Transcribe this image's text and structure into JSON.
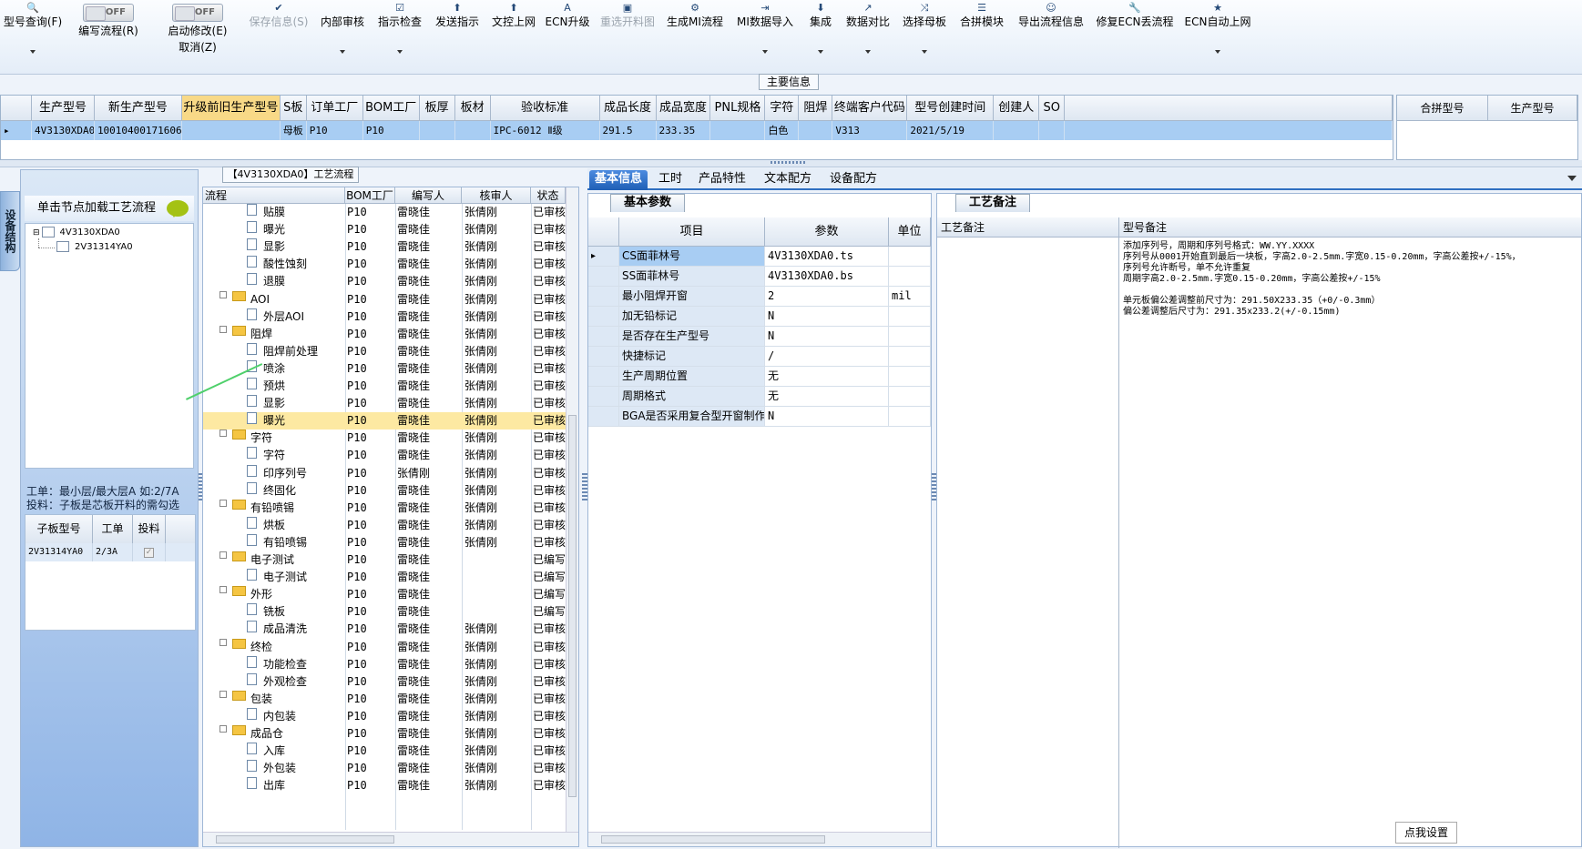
{
  "toolbar": {
    "items": [
      {
        "icon": "🔍",
        "label": "型号查询(F)",
        "caret": true,
        "disabled": false,
        "w": 72
      },
      {
        "toggle": true,
        "state": "OFF",
        "label": "编写流程(R)",
        "w": 94
      },
      {
        "toggle": true,
        "state": "OFF",
        "label": "启动修改(E)",
        "label2": "取消(Z)",
        "w": 102
      },
      {
        "icon": "✔",
        "label": "保存信息(S)",
        "caret": false,
        "disabled": true,
        "w": 76
      },
      {
        "icon": "",
        "label": "内部审核",
        "caret": true,
        "disabled": false,
        "w": 64
      },
      {
        "icon": "☑",
        "label": "指示检查",
        "caret": true,
        "disabled": false,
        "w": 62
      },
      {
        "icon": "⬆",
        "label": "发送指示",
        "caret": false,
        "disabled": false,
        "w": 64
      },
      {
        "icon": "⬆",
        "label": "文控上网",
        "caret": false,
        "disabled": false,
        "w": 60
      },
      {
        "icon": "A",
        "label": "ECN升级",
        "caret": false,
        "disabled": false,
        "w": 58
      },
      {
        "icon": "▣",
        "label": "重选开料图",
        "caret": false,
        "disabled": true,
        "w": 74
      },
      {
        "icon": "⚙",
        "label": "生成MI流程",
        "caret": false,
        "disabled": false,
        "w": 74
      },
      {
        "icon": "⇥",
        "label": "MI数据导入",
        "caret": true,
        "disabled": false,
        "w": 80
      },
      {
        "icon": "⬇",
        "label": "集成",
        "caret": true,
        "disabled": false,
        "w": 42
      },
      {
        "icon": "↗",
        "label": "数据对比",
        "caret": true,
        "disabled": false,
        "w": 62
      },
      {
        "icon": "⤨",
        "label": "选择母板",
        "caret": true,
        "disabled": false,
        "w": 62
      },
      {
        "icon": "☰",
        "label": "合拼模块",
        "caret": false,
        "disabled": false,
        "w": 64
      },
      {
        "icon": "☺",
        "label": "导出流程信息",
        "caret": false,
        "disabled": false,
        "w": 88
      },
      {
        "icon": "🔧",
        "label": "修复ECN丢流程",
        "caret": false,
        "disabled": false,
        "w": 96
      },
      {
        "icon": "★",
        "label": "ECN自动上网",
        "caret": true,
        "disabled": false,
        "w": 86
      }
    ]
  },
  "main_info_label": "主要信息",
  "main_grid": {
    "columns": [
      {
        "label": "",
        "w": 34
      },
      {
        "label": "生产型号",
        "w": 69
      },
      {
        "label": "新生产型号",
        "w": 96
      },
      {
        "label": "升级前旧生产型号",
        "w": 108,
        "hl": true
      },
      {
        "label": "S板",
        "w": 29
      },
      {
        "label": "订单工厂",
        "w": 62
      },
      {
        "label": "BOM工厂",
        "w": 62
      },
      {
        "label": "板厚",
        "w": 39
      },
      {
        "label": "板材",
        "w": 39
      },
      {
        "label": "验收标准",
        "w": 120
      },
      {
        "label": "成品长度",
        "w": 62
      },
      {
        "label": "成品宽度",
        "w": 60
      },
      {
        "label": "PNL规格",
        "w": 60
      },
      {
        "label": "字符",
        "w": 37
      },
      {
        "label": "阻焊",
        "w": 37
      },
      {
        "label": "终端客户代码",
        "w": 82
      },
      {
        "label": "型号创建时间",
        "w": 95
      },
      {
        "label": "创建人",
        "w": 50
      },
      {
        "label": "SO",
        "w": 28
      },
      {
        "label": "",
        "w": 360
      }
    ],
    "row": [
      "▸",
      "4V3130XDA0",
      "10010400171606",
      "",
      "母板",
      "P10",
      "P10",
      "",
      "",
      "IPC-6012 Ⅱ级",
      "291.5",
      "233.35",
      "",
      "白色",
      "",
      "V313",
      "2021/5/19",
      "",
      "",
      ""
    ]
  },
  "side_grid": {
    "columns": [
      "合拼型号",
      "生产型号"
    ]
  },
  "left_tab_label": "设备结构",
  "left_panel": {
    "hint": "单击节点加载工艺流程",
    "tree": [
      "4V3130XDA0",
      "2V31314YA0"
    ],
    "info_line1": "工单：最小层/最大层A 如:2/7A",
    "info_line2": "投料：子板是芯板开料的需勾选",
    "sub_grid": {
      "columns": [
        "子板型号",
        "工单",
        "投料"
      ],
      "row": {
        "model": "2V31314YA0",
        "order": "2/3A",
        "feed_mark": "✓"
      }
    }
  },
  "process_title": "【4V3130XDA0】工艺流程",
  "process_grid": {
    "columns": [
      "流程",
      "BOM工厂",
      "编写人",
      "核审人",
      "状态"
    ],
    "rows": [
      {
        "t": "c",
        "name": "贴膜",
        "bom": "P10",
        "w": "雷晓佳",
        "r": "张倩刚",
        "s": "已审核"
      },
      {
        "t": "c",
        "name": "曝光",
        "bom": "P10",
        "w": "雷晓佳",
        "r": "张倩刚",
        "s": "已审核"
      },
      {
        "t": "c",
        "name": "显影",
        "bom": "P10",
        "w": "雷晓佳",
        "r": "张倩刚",
        "s": "已审核"
      },
      {
        "t": "c",
        "name": "酸性蚀刻",
        "bom": "P10",
        "w": "雷晓佳",
        "r": "张倩刚",
        "s": "已审核"
      },
      {
        "t": "c",
        "name": "退膜",
        "bom": "P10",
        "w": "雷晓佳",
        "r": "张倩刚",
        "s": "已审核"
      },
      {
        "t": "g",
        "name": "AOI",
        "bom": "P10",
        "w": "雷晓佳",
        "r": "张倩刚",
        "s": "已审核"
      },
      {
        "t": "c",
        "name": "外层AOI",
        "bom": "P10",
        "w": "雷晓佳",
        "r": "张倩刚",
        "s": "已审核"
      },
      {
        "t": "g",
        "name": "阻焊",
        "bom": "P10",
        "w": "雷晓佳",
        "r": "张倩刚",
        "s": "已审核"
      },
      {
        "t": "c",
        "name": "阻焊前处理",
        "bom": "P10",
        "w": "雷晓佳",
        "r": "张倩刚",
        "s": "已审核"
      },
      {
        "t": "c",
        "name": "喷涂",
        "bom": "P10",
        "w": "雷晓佳",
        "r": "张倩刚",
        "s": "已审核"
      },
      {
        "t": "c",
        "name": "预烘",
        "bom": "P10",
        "w": "雷晓佳",
        "r": "张倩刚",
        "s": "已审核"
      },
      {
        "t": "c",
        "name": "显影",
        "bom": "P10",
        "w": "雷晓佳",
        "r": "张倩刚",
        "s": "已审核"
      },
      {
        "t": "c",
        "name": "曝光",
        "bom": "P10",
        "w": "雷晓佳",
        "r": "张倩刚",
        "s": "已审核",
        "sel": true
      },
      {
        "t": "g",
        "name": "字符",
        "bom": "P10",
        "w": "雷晓佳",
        "r": "张倩刚",
        "s": "已审核"
      },
      {
        "t": "c",
        "name": "字符",
        "bom": "P10",
        "w": "雷晓佳",
        "r": "张倩刚",
        "s": "已审核"
      },
      {
        "t": "c",
        "name": "印序列号",
        "bom": "P10",
        "w": "张倩刚",
        "r": "张倩刚",
        "s": "已审核"
      },
      {
        "t": "c",
        "name": "终固化",
        "bom": "P10",
        "w": "雷晓佳",
        "r": "张倩刚",
        "s": "已审核"
      },
      {
        "t": "g",
        "name": "有铅喷锡",
        "bom": "P10",
        "w": "雷晓佳",
        "r": "张倩刚",
        "s": "已审核"
      },
      {
        "t": "c",
        "name": "烘板",
        "bom": "P10",
        "w": "雷晓佳",
        "r": "张倩刚",
        "s": "已审核"
      },
      {
        "t": "c",
        "name": "有铅喷锡",
        "bom": "P10",
        "w": "雷晓佳",
        "r": "张倩刚",
        "s": "已审核"
      },
      {
        "t": "g",
        "name": "电子测试",
        "bom": "P10",
        "w": "雷晓佳",
        "r": "",
        "s": "已编写"
      },
      {
        "t": "c",
        "name": "电子测试",
        "bom": "P10",
        "w": "雷晓佳",
        "r": "",
        "s": "已编写"
      },
      {
        "t": "g",
        "name": "外形",
        "bom": "P10",
        "w": "雷晓佳",
        "r": "",
        "s": "已编写"
      },
      {
        "t": "c",
        "name": "铣板",
        "bom": "P10",
        "w": "雷晓佳",
        "r": "",
        "s": "已编写"
      },
      {
        "t": "c",
        "name": "成品清洗",
        "bom": "P10",
        "w": "雷晓佳",
        "r": "张倩刚",
        "s": "已审核"
      },
      {
        "t": "g",
        "name": "终检",
        "bom": "P10",
        "w": "雷晓佳",
        "r": "张倩刚",
        "s": "已审核"
      },
      {
        "t": "c",
        "name": "功能检查",
        "bom": "P10",
        "w": "雷晓佳",
        "r": "张倩刚",
        "s": "已审核"
      },
      {
        "t": "c",
        "name": "外观检查",
        "bom": "P10",
        "w": "雷晓佳",
        "r": "张倩刚",
        "s": "已审核"
      },
      {
        "t": "g",
        "name": "包装",
        "bom": "P10",
        "w": "雷晓佳",
        "r": "张倩刚",
        "s": "已审核"
      },
      {
        "t": "c",
        "name": "内包装",
        "bom": "P10",
        "w": "雷晓佳",
        "r": "张倩刚",
        "s": "已审核"
      },
      {
        "t": "g",
        "name": "成品仓",
        "bom": "P10",
        "w": "雷晓佳",
        "r": "张倩刚",
        "s": "已审核"
      },
      {
        "t": "c",
        "name": "入库",
        "bom": "P10",
        "w": "雷晓佳",
        "r": "张倩刚",
        "s": "已审核"
      },
      {
        "t": "c",
        "name": "外包装",
        "bom": "P10",
        "w": "雷晓佳",
        "r": "张倩刚",
        "s": "已审核"
      },
      {
        "t": "c",
        "name": "出库",
        "bom": "P10",
        "w": "雷晓佳",
        "r": "张倩刚",
        "s": "已审核"
      }
    ]
  },
  "right_tabs": [
    "基本信息",
    "工时",
    "产品特性",
    "文本配方",
    "设备配方"
  ],
  "basic_params": {
    "tab_label": "基本参数",
    "columns": [
      "项目",
      "参数",
      "单位"
    ],
    "rows": [
      {
        "k": "CS面菲林号",
        "v": "4V3130XDA0.ts",
        "u": "",
        "cur": true
      },
      {
        "k": "SS面菲林号",
        "v": "4V3130XDA0.bs",
        "u": ""
      },
      {
        "k": "最小阻焊开窗",
        "v": "2",
        "u": "mil"
      },
      {
        "k": "加无铅标记",
        "v": "N",
        "u": ""
      },
      {
        "k": "是否存在生产型号",
        "v": "N",
        "u": ""
      },
      {
        "k": "快捷标记",
        "v": "/",
        "u": ""
      },
      {
        "k": "生产周期位置",
        "v": "无",
        "u": ""
      },
      {
        "k": "周期格式",
        "v": "无",
        "u": ""
      },
      {
        "k": "BGA是否采用复合型开窗制作",
        "v": "N",
        "u": ""
      }
    ]
  },
  "process_remarks": {
    "tab_label": "工艺备注",
    "col1": "工艺备注",
    "col2": "型号备注",
    "text": "添加序列号，周期和序列号格式：WW.YY.XXXX\n序列号从0001开始直到最后一块板，字高2.0-2.5mm.字宽0.15-0.20mm，字高公差按+/-15%，\n序列号允许断号，单不允许重复\n周期字高2.0-2.5mm.字宽0.15-0.20mm，字高公差按+/-15%\n\n单元板偏公差调整前尺寸为：291.50X233.35（+0/-0.3mm）\n偏公差调整后尺寸为：291.35x233.2(+/-0.15mm)"
  },
  "click_settings": "点我设置"
}
